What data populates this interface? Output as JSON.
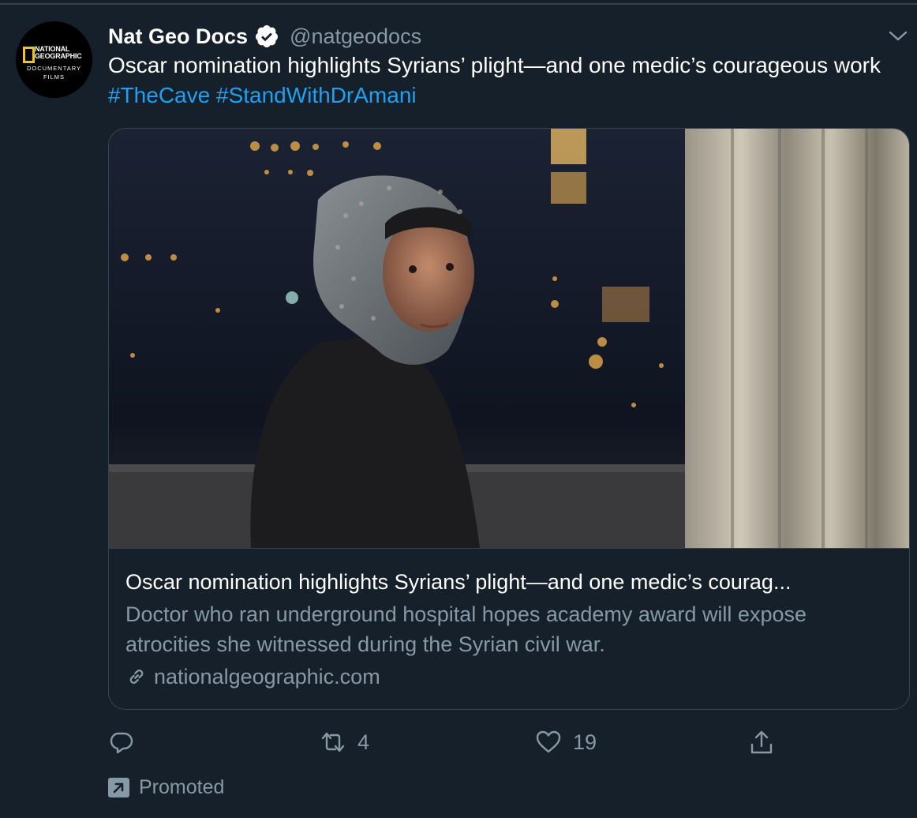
{
  "tweet": {
    "author": {
      "name": "Nat Geo Docs",
      "handle": "@natgeodocs",
      "verified": true,
      "avatar_text": {
        "line1": "NATIONAL",
        "line2": "GEOGRAPHIC",
        "line3": "DOCUMENTARY",
        "line4": "FILMS"
      }
    },
    "text": "Oscar nomination highlights Syrians’ plight—and one medic’s courageous work ",
    "hashtags": [
      "#TheCave",
      "#StandWithDrAmani"
    ],
    "card": {
      "image_icon": "photo-of-woman-in-headscarf-by-window",
      "title": "Oscar nomination highlights Syrians’ plight—and one medic’s courag...",
      "description": "Doctor who ran underground hospital hopes academy award will expose atrocities she witnessed during the Syrian civil war.",
      "domain": "nationalgeographic.com"
    },
    "actions": {
      "reply_count": "",
      "retweet_count": "4",
      "like_count": "19"
    },
    "promoted_label": "Promoted"
  },
  "colors": {
    "background": "#15202b",
    "border": "#38444d",
    "secondary_text": "#8899a6",
    "link": "#1da1f2",
    "logo_yellow": "#f2c800"
  }
}
